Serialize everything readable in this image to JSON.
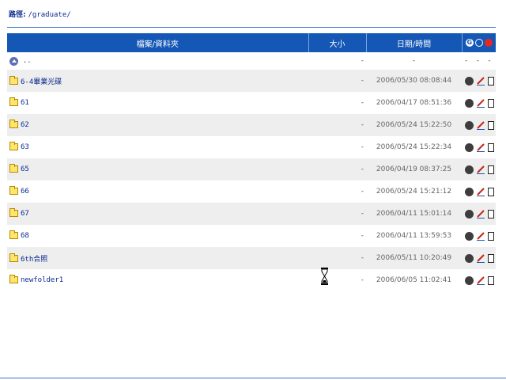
{
  "path": {
    "label": "路徑:",
    "value": "/graduate/"
  },
  "columns": {
    "name": "檔案/資料夾",
    "size": "大小",
    "date": "日期/時間"
  },
  "header_icons": {
    "get": "G"
  },
  "up_row": {
    "name": "..",
    "size": "-",
    "date": "-",
    "act1": "-",
    "act2": "-",
    "act3": "-"
  },
  "rows": [
    {
      "name": "6-4畢業光碟",
      "size": "-",
      "date": "2006/05/30 08:08:44"
    },
    {
      "name": "61",
      "size": "-",
      "date": "2006/04/17 08:51:36"
    },
    {
      "name": "62",
      "size": "-",
      "date": "2006/05/24 15:22:50"
    },
    {
      "name": "63",
      "size": "-",
      "date": "2006/05/24 15:22:34"
    },
    {
      "name": "65",
      "size": "-",
      "date": "2006/04/19 08:37:25"
    },
    {
      "name": "66",
      "size": "-",
      "date": "2006/05/24 15:21:12"
    },
    {
      "name": "67",
      "size": "-",
      "date": "2006/04/11 15:01:14"
    },
    {
      "name": "68",
      "size": "-",
      "date": "2006/04/11 13:59:53"
    },
    {
      "name": "6th合照",
      "size": "-",
      "date": "2006/05/11 10:20:49"
    },
    {
      "name": "newfolder1",
      "size": "-",
      "date": "2006/06/05 11:02:41"
    }
  ],
  "colors": {
    "header_bg": "#1457b4",
    "link": "#0a2a8c",
    "alt_row": "#eeeeee",
    "delete": "#e8281e"
  }
}
